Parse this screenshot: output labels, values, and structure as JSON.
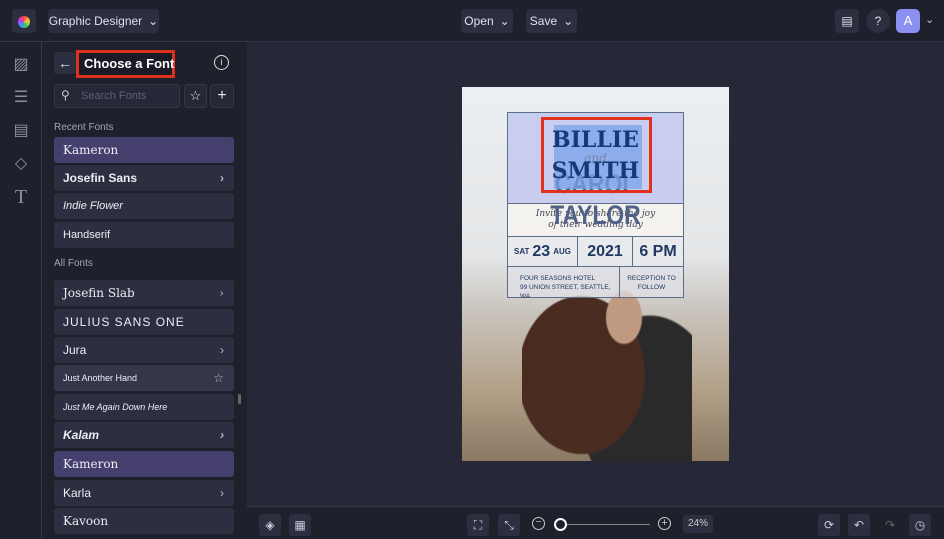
{
  "header": {
    "project": "Graphic Designer",
    "open": "Open",
    "save": "Save",
    "avatar": "A"
  },
  "panel": {
    "title": "Choose a Font",
    "search_placeholder": "Search Fonts",
    "recent_label": "Recent Fonts",
    "all_label": "All Fonts",
    "recent": [
      {
        "name": "Kameron",
        "selected": true
      },
      {
        "name": "Josefin Sans",
        "chevron": true
      },
      {
        "name": "Indie Flower"
      },
      {
        "name": "Handserif"
      }
    ],
    "all": [
      {
        "name": "Josefin Slab",
        "chevron": true
      },
      {
        "name": "JULIUS SANS ONE"
      },
      {
        "name": "Jura",
        "chevron": true
      },
      {
        "name": "Just Another Hand",
        "star": true
      },
      {
        "name": "Just Me Again Down Here"
      },
      {
        "name": "Kalam",
        "chevron": true
      },
      {
        "name": "Kameron",
        "selected": true
      },
      {
        "name": "Karla",
        "chevron": true
      },
      {
        "name": "Kavoon"
      }
    ]
  },
  "poster": {
    "name1": "BILLIE",
    "and": "and",
    "name2": "SMITH",
    "name_behind": "CAROL TAYLOR",
    "invite1": "Invite you to share the joy",
    "invite2": "of their wedding day",
    "day": "SAT",
    "date": "23",
    "month": "AUG",
    "year": "2021",
    "time": "6 PM",
    "venue1": "FOUR SEASONS HOTEL",
    "venue2": "99 UNION STREET, SEATTLE, WA",
    "reception1": "RECEPTION TO",
    "reception2": "FOLLOW"
  },
  "zoom": {
    "label": "24%",
    "slider_fraction": 0.05
  },
  "colors": {
    "accent": "#e0301e",
    "selected": "#453f6e",
    "avatar": "#8b8ff0"
  }
}
